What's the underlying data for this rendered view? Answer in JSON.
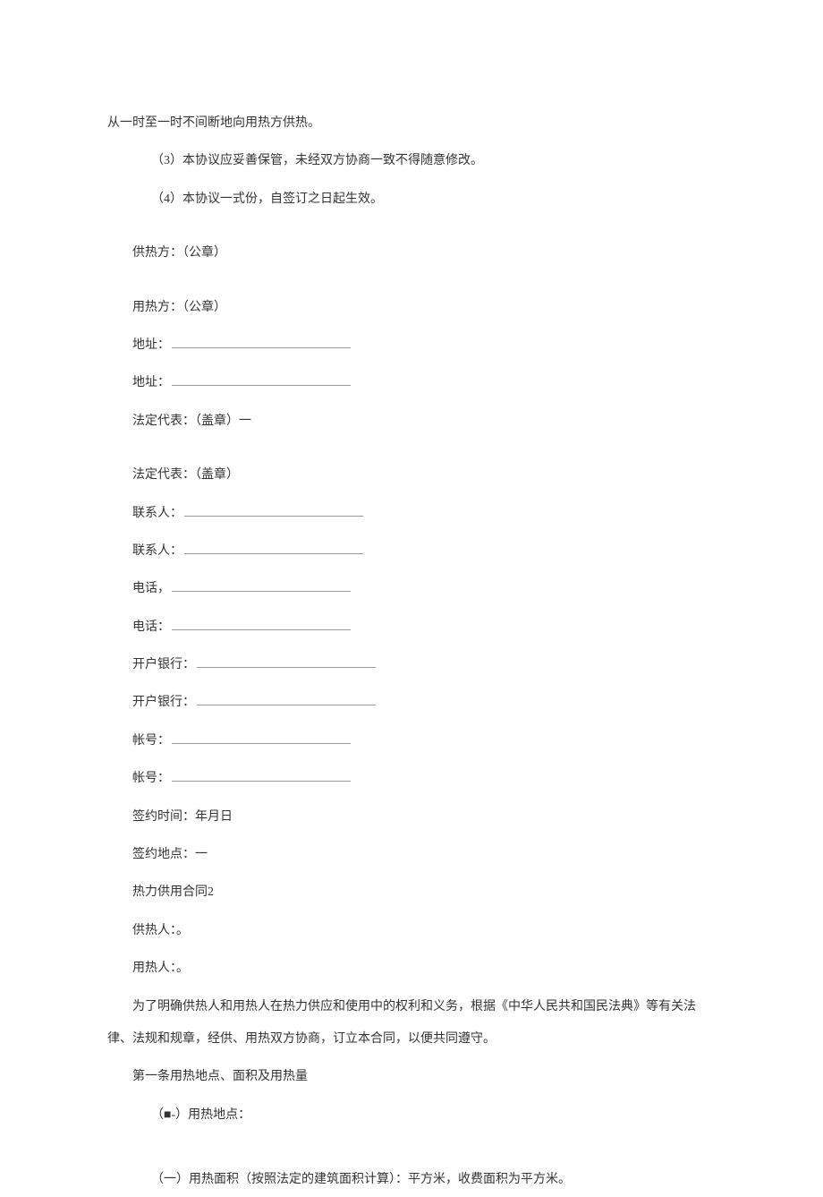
{
  "p0": "从一时至一时不间断地向用热方供热。",
  "p1": "（3）本协议应妥善保管，未经双方协商一致不得随意修改。",
  "p2": "（4）本协议一式份，自签订之日起生效。",
  "p3": "供热方：（公章）",
  "p4": "用热方：（公章）",
  "p5": "地址：",
  "p6": "地址：",
  "p7": "法定代表：（盖章）一",
  "p8": "法定代表：（盖章）",
  "p9": "联系人：",
  "p10": "联系人：",
  "p11": "电话，",
  "p12": "电话：",
  "p13": "开户银行：",
  "p14": "开户银行：",
  "p15": "帐号：",
  "p16": "帐号：",
  "p17": "签约时间：年月日",
  "p18": "签约地点：一",
  "p19": "热力供用合同2",
  "p20": "供热人：。",
  "p21": "用热人：。",
  "p22": "为了明确供热人和用热人在热力供应和使用中的权利和义务，根据《中华人民共和国民法典》等有关法律、法规和规章，经供、用热双方协商，订立本合同，以便共同遵守。",
  "p23": "第一条用热地点、面积及用热量",
  "p24": "（■-）用热地点：",
  "p25": "（一）用热面积（按照法定的建筑面积计算）：平方米，收费面积为平方米。"
}
